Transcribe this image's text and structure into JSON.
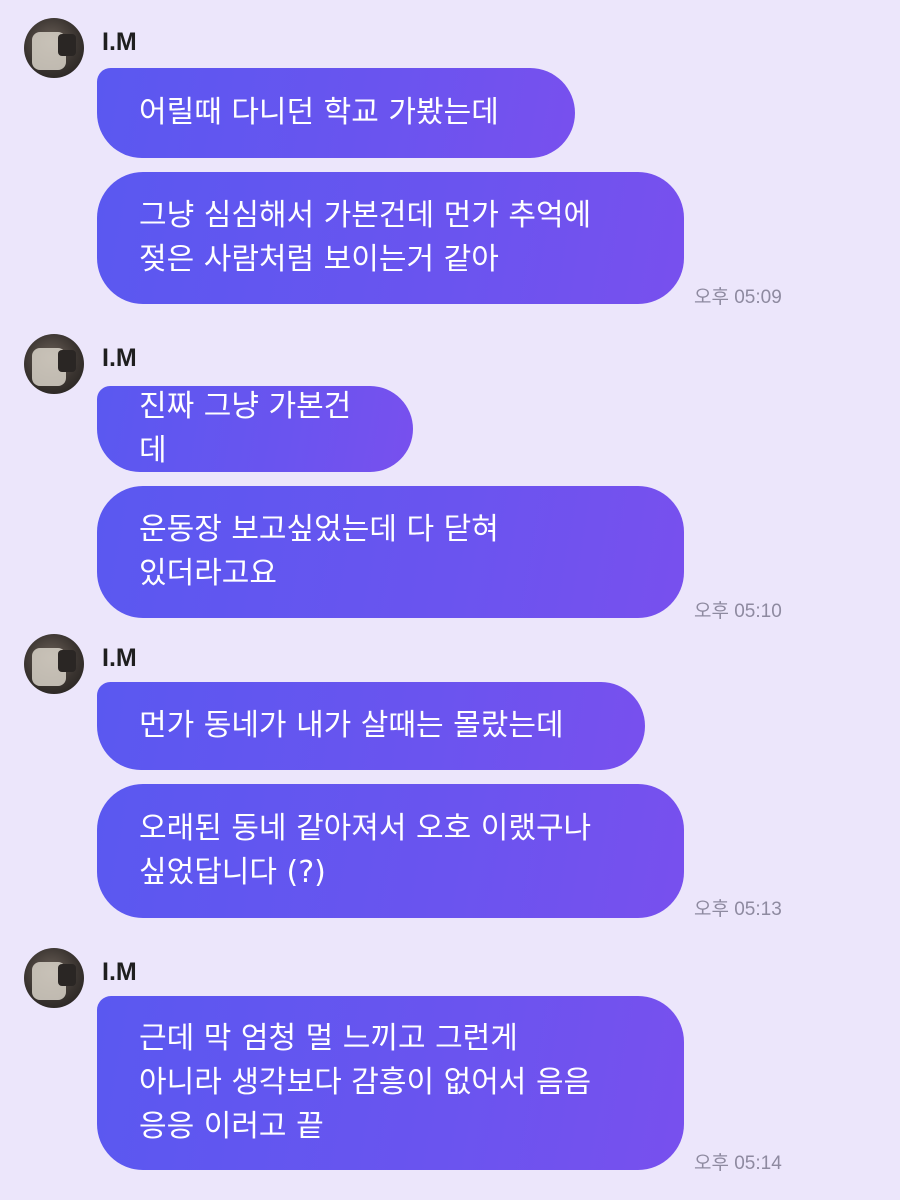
{
  "chat": {
    "groups": [
      {
        "sender": "I.M",
        "messages": [
          "어릴때 다니던 학교 가봤는데",
          "그냥 심심해서 가본건데 먼가 추억에\n젖은 사람처럼 보이는거 같아"
        ],
        "time": "오후 05:09"
      },
      {
        "sender": "I.M",
        "messages": [
          "진짜 그냥 가본건데",
          "운동장 보고싶었는데 다 닫혀\n있더라고요"
        ],
        "time": "오후 05:10"
      },
      {
        "sender": "I.M",
        "messages": [
          "먼가 동네가 내가 살때는 몰랐는데",
          "오래된 동네 같아져서 오호 이랬구나\n싶었답니다 (?)"
        ],
        "time": "오후 05:13"
      },
      {
        "sender": "I.M",
        "messages": [
          "근데 막 엄청 멀 느끼고 그런게\n아니라 생각보다 감흥이 없어서 음음\n응응 이러고 끝"
        ],
        "time": "오후 05:14"
      }
    ]
  }
}
